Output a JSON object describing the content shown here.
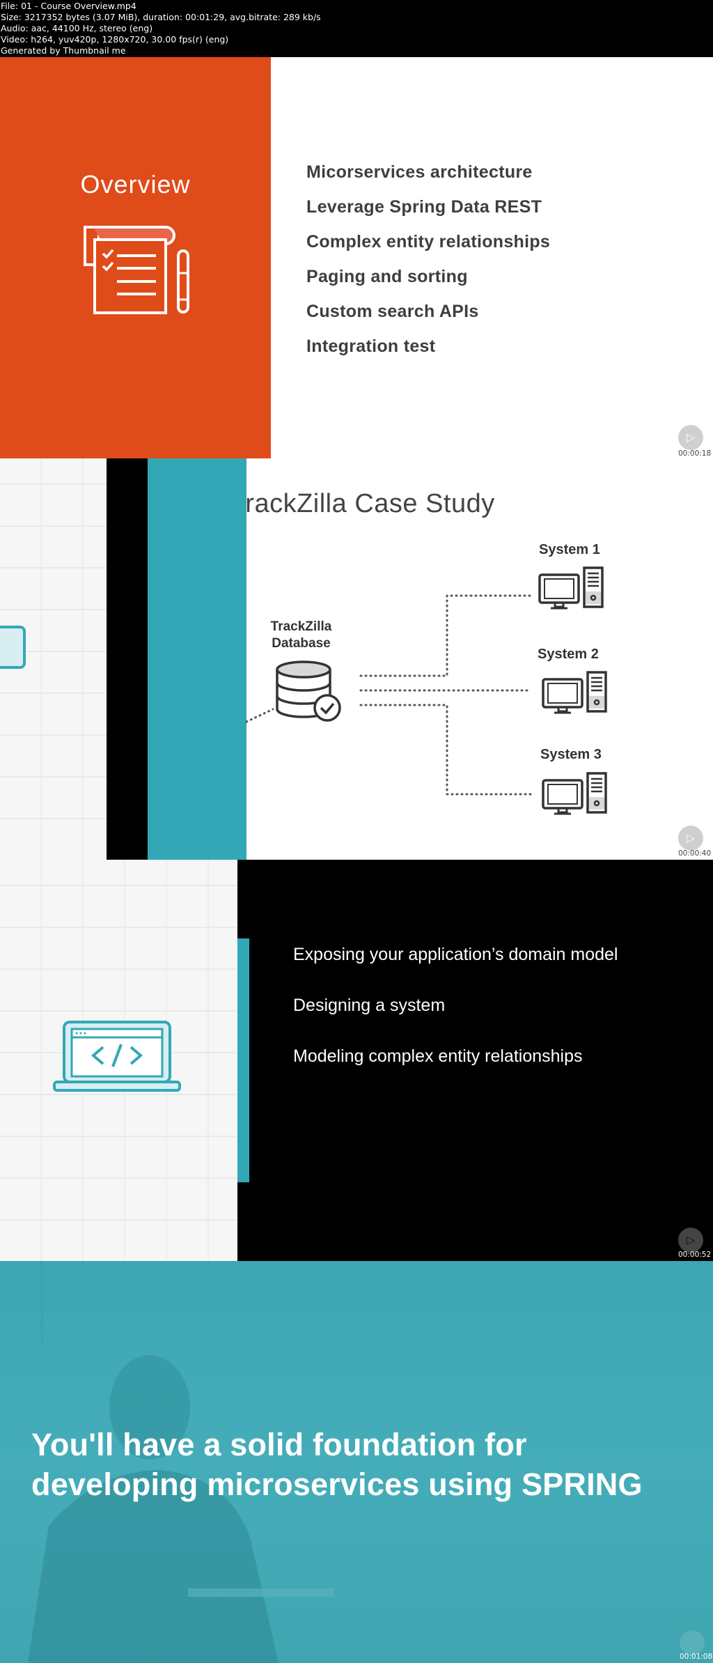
{
  "header": {
    "lines": [
      "File: 01 - Course Overview.mp4",
      "Size: 3217352 bytes (3.07 MiB), duration: 00:01:29, avg.bitrate: 289 kb/s",
      "Audio: aac, 44100 Hz, stereo (eng)",
      "Video: h264, yuv420p, 1280x720, 30.00 fps(r) (eng)",
      "Generated by Thumbnail me"
    ]
  },
  "frames": [
    {
      "title": "Overview",
      "icon": "checklist-notepad-icon",
      "items": [
        "Micorservices architecture",
        "Leverage Spring Data REST",
        "Complex entity relationships",
        "Paging and sorting",
        "Custom search APIs",
        "Integration test"
      ],
      "timestamp": "00:00:18",
      "colors": {
        "panel": "#e04b1a",
        "text": "#3e3e3e"
      }
    },
    {
      "title": "TrackZilla Case Study",
      "database_label_line1": "TrackZilla",
      "database_label_line2": "Database",
      "systems": [
        "System 1",
        "System 2",
        "System 3"
      ],
      "timestamp": "00:00:40",
      "colors": {
        "accent": "#32a8b6"
      }
    },
    {
      "items": [
        "Exposing your application’s domain model",
        "Designing a system",
        "Modeling complex entity relationships"
      ],
      "icon": "laptop-code-icon",
      "timestamp": "00:00:52",
      "colors": {
        "accent": "#32a8b6"
      }
    },
    {
      "quote_line1": "You'll have a solid foundation for",
      "quote_line2": "developing microservices using SPRING",
      "timestamp": "00:01:08",
      "colors": {
        "overlay": "#3da7b4"
      }
    }
  ]
}
